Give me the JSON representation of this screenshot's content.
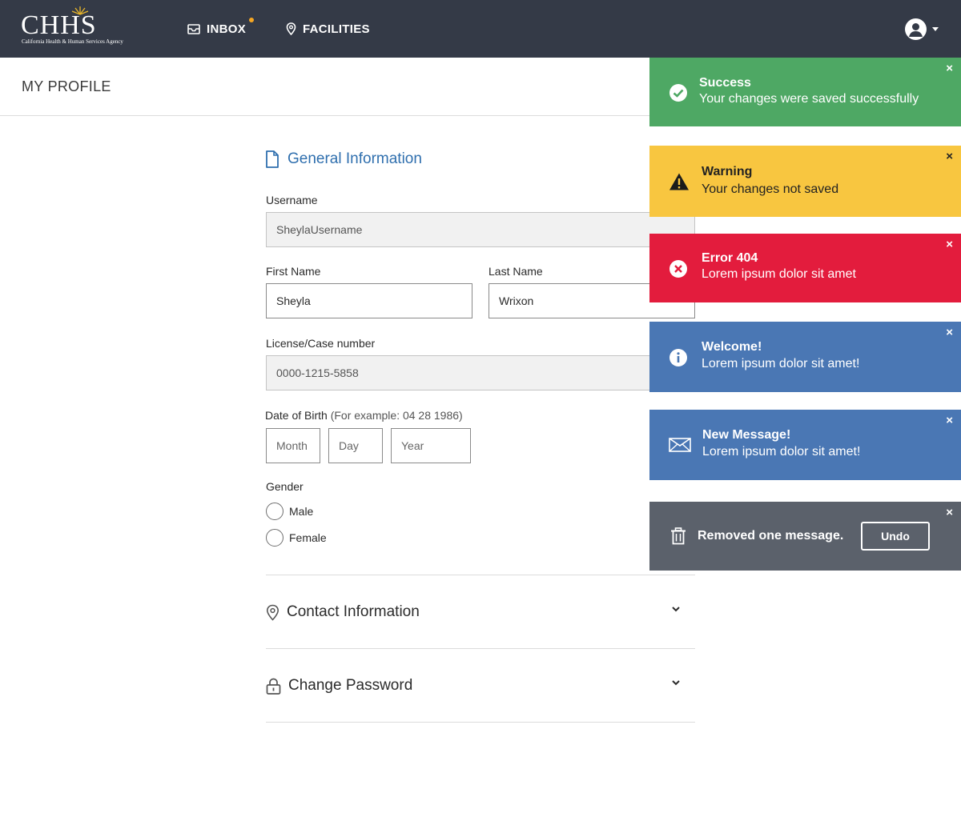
{
  "header": {
    "logo_text": "CHHS",
    "logo_subtitle": "California Health & Human Services Agency",
    "nav": [
      {
        "label": "INBOX",
        "icon": "inbox-icon"
      },
      {
        "label": "FACILITIES",
        "icon": "map-pin-icon"
      }
    ],
    "user_icon": "user-circle-icon"
  },
  "page": {
    "title": "MY PROFILE"
  },
  "general": {
    "title": "General Information",
    "icon": "document-icon",
    "username_label": "Username",
    "username_value": "SheylaUsername",
    "first_name_label": "First Name",
    "first_name_value": "Sheyla",
    "last_name_label": "Last Name",
    "last_name_value": "Wrixon",
    "license_label": "License/Case number",
    "license_value": "0000-1215-5858",
    "dob_label": "Date of Birth",
    "dob_hint": "(For example: 04 28 1986)",
    "dob_month_placeholder": "Month",
    "dob_day_placeholder": "Day",
    "dob_year_placeholder": "Year",
    "gender_label": "Gender",
    "gender_options": [
      "Male",
      "Female"
    ]
  },
  "sections": [
    {
      "title": "Contact Information",
      "icon": "map-pin-icon"
    },
    {
      "title": "Change Password",
      "icon": "lock-icon"
    }
  ],
  "toasts": {
    "success": {
      "title": "Success",
      "message": "Your changes were saved successfully",
      "icon": "check-circle-icon",
      "color": "#4ea864"
    },
    "warning": {
      "title": "Warning",
      "message": "Your changes not saved",
      "icon": "warning-triangle-icon",
      "color": "#f8c640"
    },
    "error": {
      "title": "Error 404",
      "message": "Lorem ipsum dolor sit amet",
      "icon": "error-circle-icon",
      "color": "#e31c3d"
    },
    "info": {
      "title": "Welcome!",
      "message": "Lorem ipsum dolor sit amet!",
      "icon": "info-circle-icon",
      "color": "#4a77b4"
    },
    "message": {
      "title": "New Message!",
      "message": "Lorem ipsum dolor sit amet!",
      "icon": "envelope-icon",
      "color": "#4a77b4"
    },
    "removed": {
      "message": "Removed one message.",
      "action_label": "Undo",
      "icon": "trash-icon",
      "color": "#5b616b"
    },
    "close_glyph": "×"
  },
  "colors": {
    "nav_bg": "#343a47",
    "link_blue": "#2f6fae",
    "inbox_dot": "#f5a623"
  }
}
